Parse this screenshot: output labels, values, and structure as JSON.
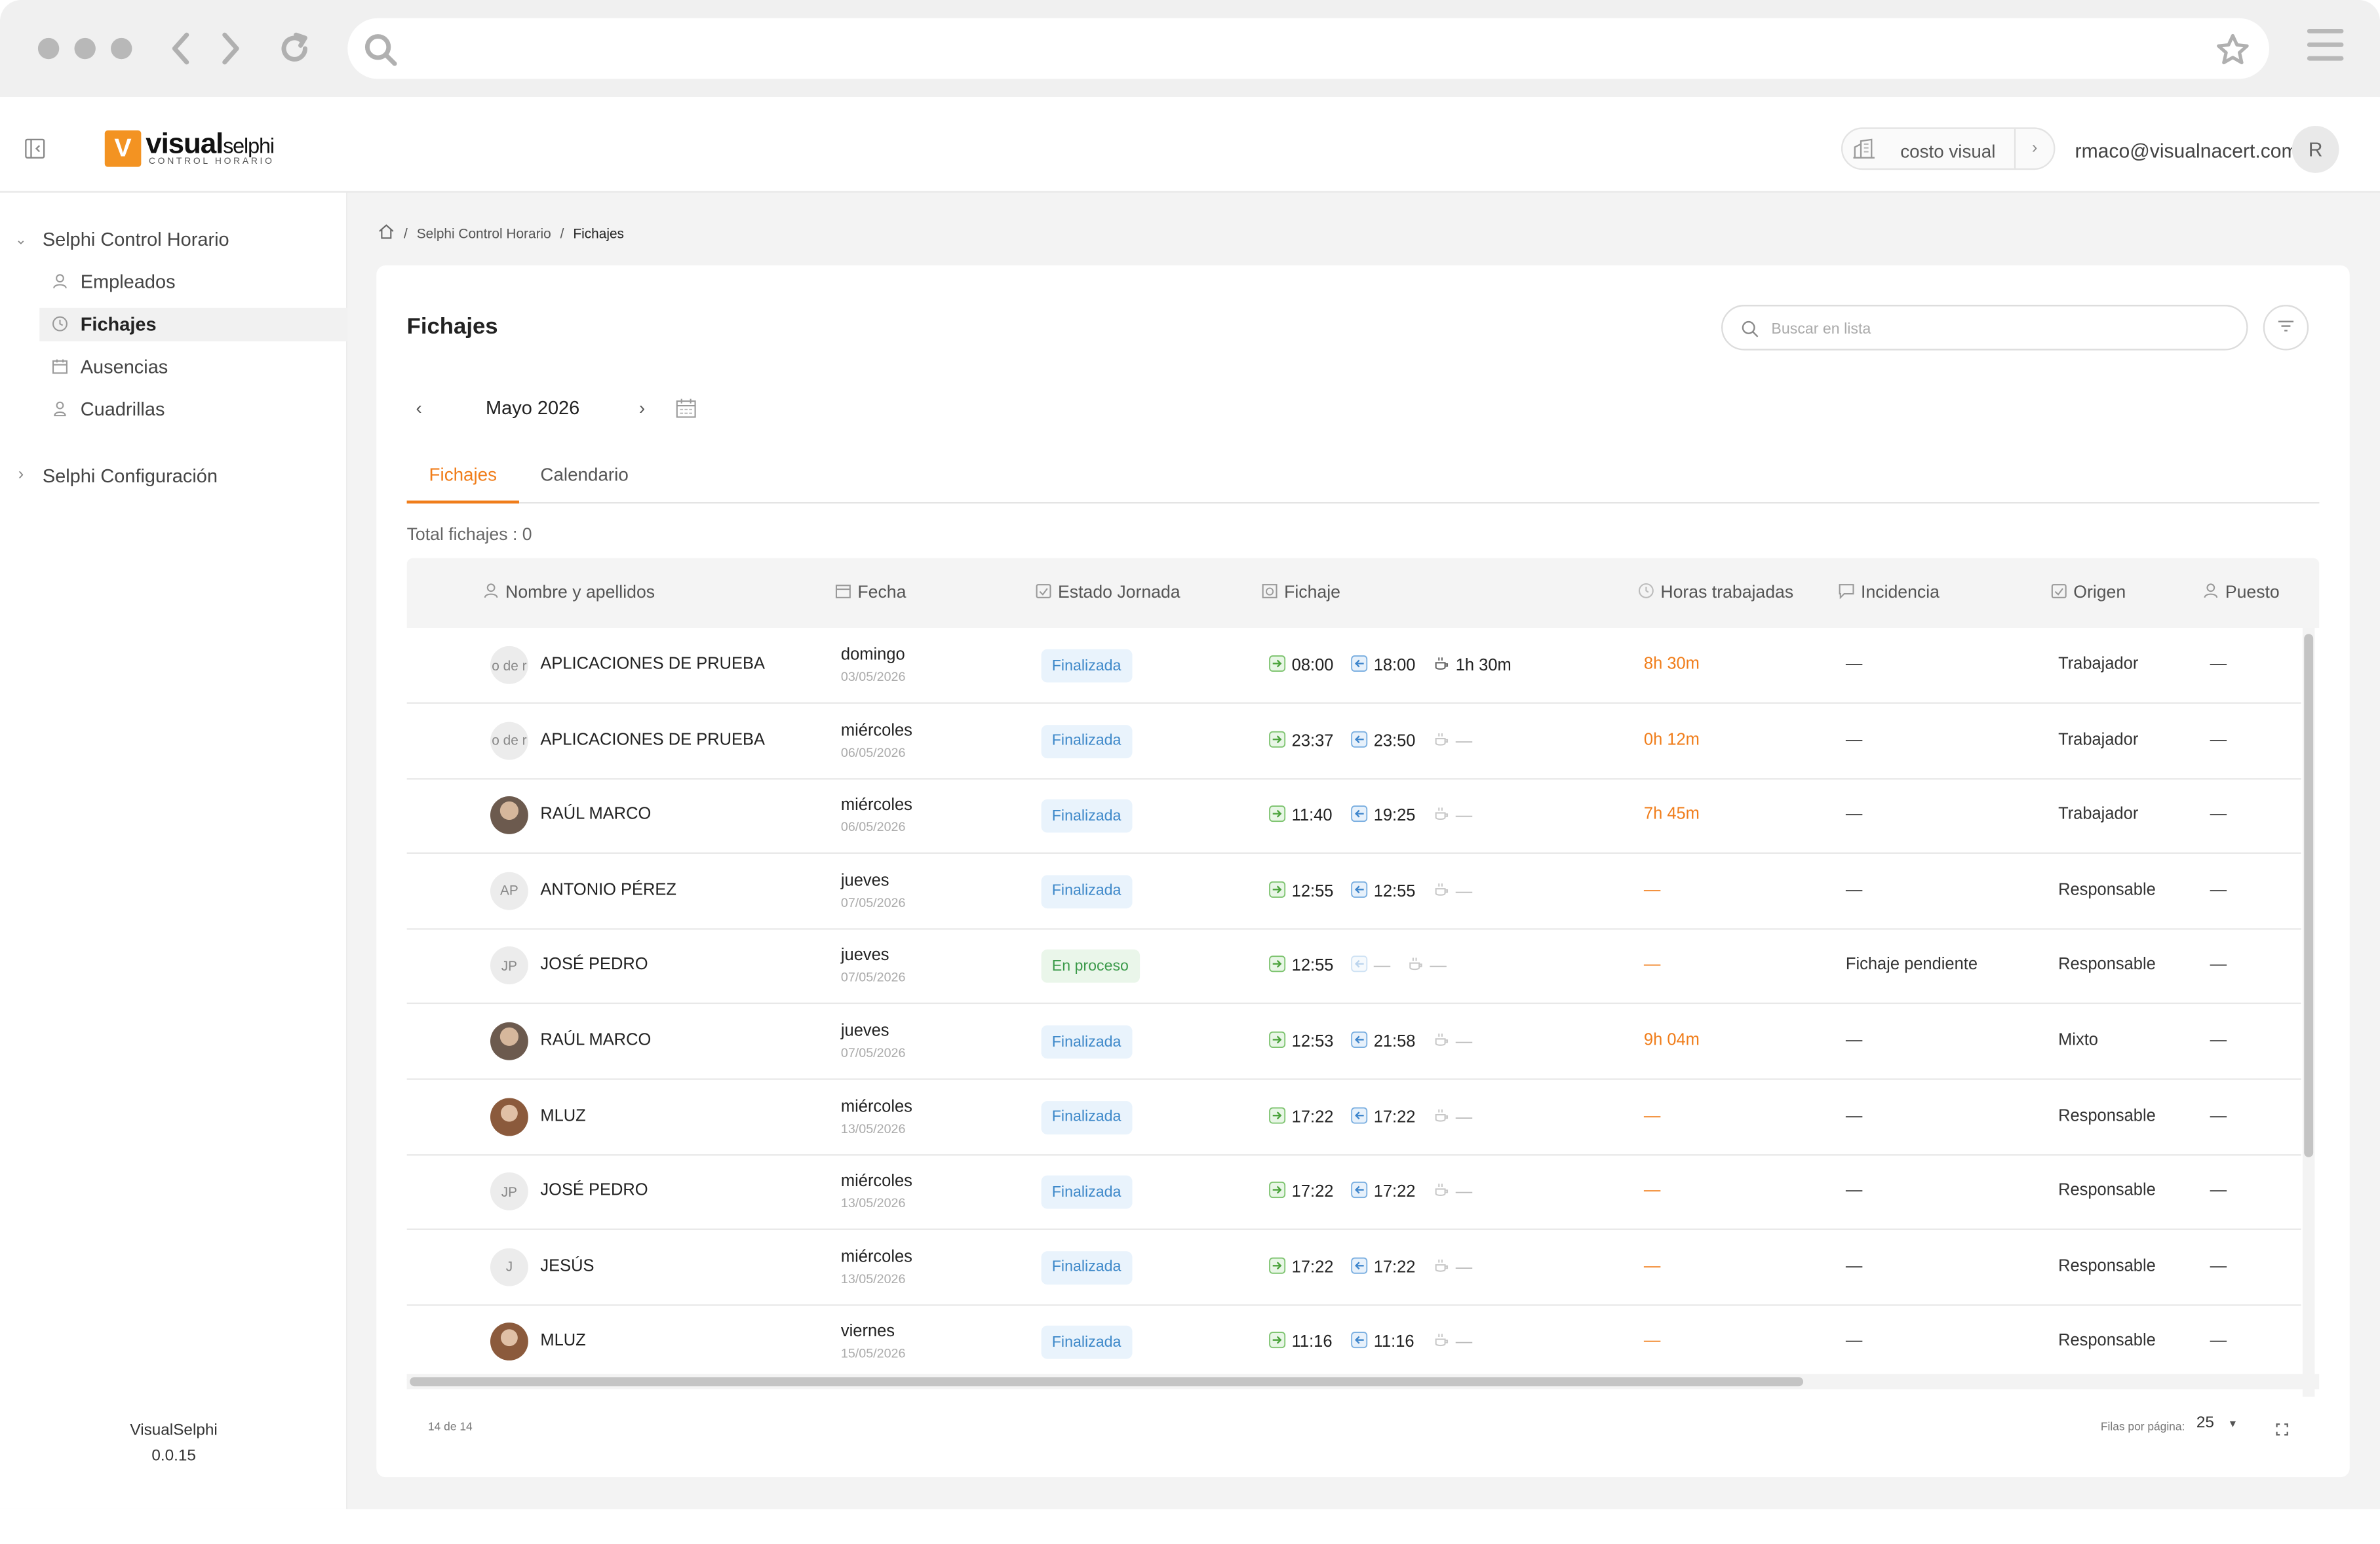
{
  "app": {
    "logo_main_bold": "visual",
    "logo_main": "selphi",
    "logo_sub": "CONTROL HORARIO",
    "company_name": "costo visual",
    "user_email": "rmaco@visualnacert.com",
    "user_initial": "R",
    "accent_color": "#f07d1a"
  },
  "sidebar": {
    "group1": "Selphi Control Horario",
    "items": [
      {
        "label": "Empleados",
        "icon": "user-icon"
      },
      {
        "label": "Fichajes",
        "icon": "clock-icon",
        "active": true
      },
      {
        "label": "Ausencias",
        "icon": "calendar-icon"
      },
      {
        "label": "Cuadrillas",
        "icon": "group-icon"
      }
    ],
    "group2": "Selphi Configuración",
    "version_name": "VisualSelphi",
    "version_number": "0.0.15"
  },
  "breadcrumb": {
    "home_icon": "home-icon",
    "item1": "Selphi Control Horario",
    "current": "Fichajes"
  },
  "page": {
    "title": "Fichajes",
    "search_placeholder": "Buscar en lista",
    "month_label": "Mayo 2026",
    "tabs": [
      "Fichajes",
      "Calendario"
    ],
    "total": "Total fichajes : 0"
  },
  "table": {
    "headers": [
      "Nombre y apellidos",
      "Fecha",
      "Estado Jornada",
      "Fichaje",
      "Horas trabajadas",
      "Incidencia",
      "Origen",
      "Puesto"
    ],
    "rows": [
      {
        "avatar": "o de r",
        "avatar_type": "text",
        "name": "APLICACIONES DE PRUEBA",
        "day": "domingo",
        "date": "03/05/2026",
        "status": "Finalizada",
        "status_type": "fin",
        "in": "08:00",
        "out": "18:00",
        "brk": "1h 30m",
        "brk_muted": false,
        "out_muted": false,
        "hours": "8h 30m",
        "incidence": "—",
        "origin": "Trabajador",
        "puesto": "—"
      },
      {
        "avatar": "o de r",
        "avatar_type": "text",
        "name": "APLICACIONES DE PRUEBA",
        "day": "miércoles",
        "date": "06/05/2026",
        "status": "Finalizada",
        "status_type": "fin",
        "in": "23:37",
        "out": "23:50",
        "brk": "—",
        "brk_muted": true,
        "out_muted": false,
        "hours": "0h 12m",
        "incidence": "—",
        "origin": "Trabajador",
        "puesto": "—"
      },
      {
        "avatar": "",
        "avatar_type": "photo",
        "name": "RAÚL MARCO",
        "day": "miércoles",
        "date": "06/05/2026",
        "status": "Finalizada",
        "status_type": "fin",
        "in": "11:40",
        "out": "19:25",
        "brk": "—",
        "brk_muted": true,
        "out_muted": false,
        "hours": "7h 45m",
        "incidence": "—",
        "origin": "Trabajador",
        "puesto": "—"
      },
      {
        "avatar": "AP",
        "avatar_type": "text",
        "name": "ANTONIO PÉREZ",
        "day": "jueves",
        "date": "07/05/2026",
        "status": "Finalizada",
        "status_type": "fin",
        "in": "12:55",
        "out": "12:55",
        "brk": "—",
        "brk_muted": true,
        "out_muted": false,
        "hours": "—",
        "incidence": "—",
        "origin": "Responsable",
        "puesto": "—"
      },
      {
        "avatar": "JP",
        "avatar_type": "text",
        "name": "JOSÉ PEDRO",
        "day": "jueves",
        "date": "07/05/2026",
        "status": "En proceso",
        "status_type": "proc",
        "in": "12:55",
        "out": "—",
        "brk": "—",
        "brk_muted": true,
        "out_muted": true,
        "hours": "—",
        "incidence": "Fichaje pendiente",
        "origin": "Responsable",
        "puesto": "—"
      },
      {
        "avatar": "",
        "avatar_type": "photo",
        "name": "RAÚL MARCO",
        "day": "jueves",
        "date": "07/05/2026",
        "status": "Finalizada",
        "status_type": "fin",
        "in": "12:53",
        "out": "21:58",
        "brk": "—",
        "brk_muted": true,
        "out_muted": false,
        "hours": "9h 04m",
        "incidence": "—",
        "origin": "Mixto",
        "puesto": "—"
      },
      {
        "avatar": "",
        "avatar_type": "photo2",
        "name": "MLUZ",
        "day": "miércoles",
        "date": "13/05/2026",
        "status": "Finalizada",
        "status_type": "fin",
        "in": "17:22",
        "out": "17:22",
        "brk": "—",
        "brk_muted": true,
        "out_muted": false,
        "hours": "—",
        "incidence": "—",
        "origin": "Responsable",
        "puesto": "—"
      },
      {
        "avatar": "JP",
        "avatar_type": "text",
        "name": "JOSÉ PEDRO",
        "day": "miércoles",
        "date": "13/05/2026",
        "status": "Finalizada",
        "status_type": "fin",
        "in": "17:22",
        "out": "17:22",
        "brk": "—",
        "brk_muted": true,
        "out_muted": false,
        "hours": "—",
        "incidence": "—",
        "origin": "Responsable",
        "puesto": "—"
      },
      {
        "avatar": "J",
        "avatar_type": "text",
        "name": "JESÚS",
        "day": "miércoles",
        "date": "13/05/2026",
        "status": "Finalizada",
        "status_type": "fin",
        "in": "17:22",
        "out": "17:22",
        "brk": "—",
        "brk_muted": true,
        "out_muted": false,
        "hours": "—",
        "incidence": "—",
        "origin": "Responsable",
        "puesto": "—"
      },
      {
        "avatar": "",
        "avatar_type": "photo2",
        "name": "MLUZ",
        "day": "viernes",
        "date": "15/05/2026",
        "status": "Finalizada",
        "status_type": "fin",
        "in": "11:16",
        "out": "11:16",
        "brk": "—",
        "brk_muted": true,
        "out_muted": false,
        "hours": "—",
        "incidence": "—",
        "origin": "Responsable",
        "puesto": "—"
      }
    ]
  },
  "footer": {
    "count": "14 de 14",
    "rows_label": "Filas por página:",
    "rows_value": "25"
  }
}
